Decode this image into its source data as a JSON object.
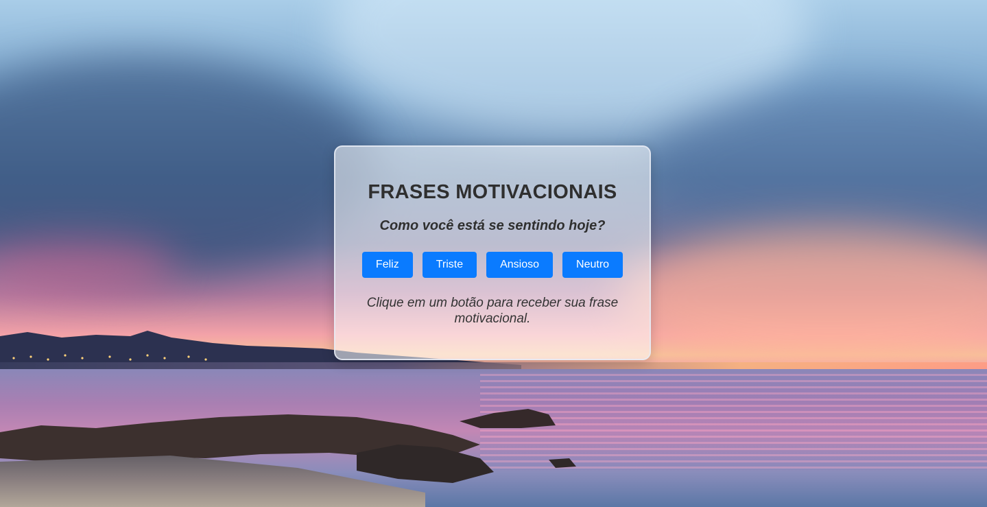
{
  "card": {
    "title": "FRASES MOTIVACIONAIS",
    "question": "Como você está se sentindo hoje?",
    "buttons": [
      {
        "label": "Feliz"
      },
      {
        "label": "Triste"
      },
      {
        "label": "Ansioso"
      },
      {
        "label": "Neutro"
      }
    ],
    "message": "Clique em um botão para receber sua frase motivacional."
  },
  "colors": {
    "button_bg": "#0a7bff",
    "button_text": "#ffffff",
    "text": "#2f2f2f"
  }
}
